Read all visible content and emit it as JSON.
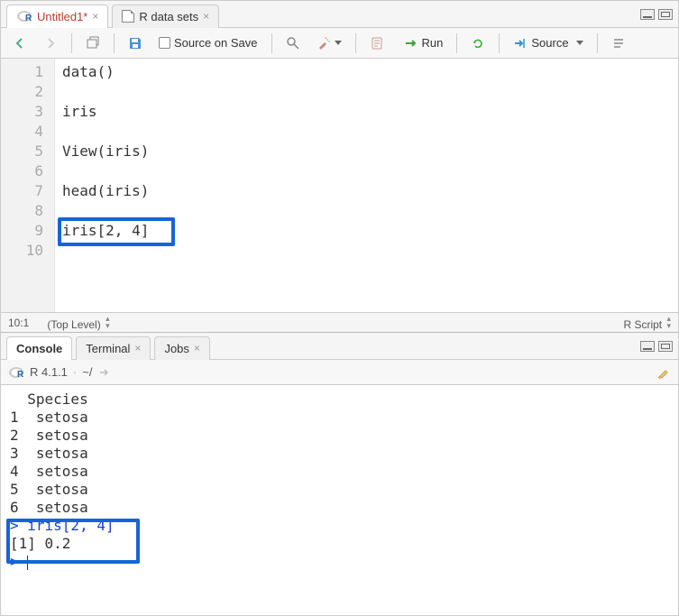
{
  "source": {
    "tabs": [
      {
        "label": "Untitled1*",
        "dirty": true,
        "icon": "r-logo"
      },
      {
        "label": "R data sets",
        "dirty": false,
        "icon": "file-icon"
      }
    ],
    "toolbar": {
      "source_on_save_label": "Source on Save",
      "run_label": "Run",
      "source_label": "Source"
    },
    "lines": [
      "data()",
      "",
      "iris",
      "",
      "View(iris)",
      "",
      "head(iris)",
      "",
      "iris[2, 4]",
      ""
    ],
    "line_numbers": [
      "1",
      "2",
      "3",
      "4",
      "5",
      "6",
      "7",
      "8",
      "9",
      "10"
    ],
    "highlighted_line_index": 8,
    "status": {
      "cursor": "10:1",
      "scope": "(Top Level)",
      "filetype": "R Script"
    }
  },
  "bottom": {
    "tabs": [
      {
        "label": "Console",
        "active": true
      },
      {
        "label": "Terminal",
        "active": false,
        "closable": true
      },
      {
        "label": "Jobs",
        "active": false,
        "closable": true
      }
    ],
    "header": {
      "version": "R 4.1.1",
      "path": "~/"
    },
    "console_lines": [
      {
        "text": "  Species",
        "cls": ""
      },
      {
        "text": "1  setosa",
        "cls": ""
      },
      {
        "text": "2  setosa",
        "cls": ""
      },
      {
        "text": "3  setosa",
        "cls": ""
      },
      {
        "text": "4  setosa",
        "cls": ""
      },
      {
        "text": "5  setosa",
        "cls": ""
      },
      {
        "text": "6  setosa",
        "cls": ""
      },
      {
        "text": "> iris[2, 4]",
        "cls": "blue-prompt"
      },
      {
        "text": "[1] 0.2",
        "cls": ""
      },
      {
        "text": "> ",
        "cls": "blue-prompt",
        "cursor": true
      }
    ]
  }
}
